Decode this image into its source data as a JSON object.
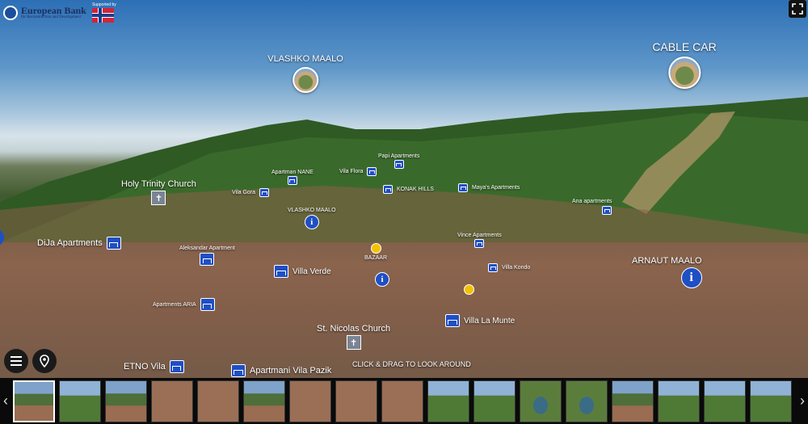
{
  "branding": {
    "bank_name": "European Bank",
    "bank_sub": "for Reconstruction and Development",
    "supported_by": "Supported by"
  },
  "hotspots": [
    {
      "label": "VLASHKO MAALO",
      "icon": "panorama-thumb"
    },
    {
      "label": "CABLE CAR",
      "icon": "panorama-thumb"
    }
  ],
  "markers": {
    "holy_trinity": "Holy Trinity Church",
    "dija": "DiJa Apartments",
    "aleksandar": "Aleksandar Apartment",
    "aria": "Apartments ARIA",
    "etno": "ETNO Vila",
    "vila_pazik": "Apartmani Vila Pazik",
    "st_nicolas": "St. Nicolas Church",
    "vila_la_munte": "Villa La Munte",
    "villa_verde": "Villa Verde",
    "bazaar": "BAZAAR",
    "vlashko_small": "VLASHKO MAALO",
    "arnaut": "ARNAUT MAALO",
    "ana": "Ana apartments",
    "papi": "Papi Apartments",
    "nane": "Apartman NANE",
    "vila_flora": "Vila Flora",
    "vila_gora": "Vila Gora",
    "konak": "KONAK HILLS",
    "maya": "Maya's Apartments",
    "vince": "Vince Apartments",
    "vila_kondo": "Villa Kondo",
    "ana_apt": "Ana apartments"
  },
  "ui": {
    "drag_hint": "CLICK & DRAG TO LOOK AROUND",
    "menu_icon": "hamburger-icon",
    "map_icon": "location-pin-icon",
    "fullscreen_icon": "fullscreen-icon"
  },
  "thumbnails": {
    "count": 18,
    "active_index": 0
  }
}
